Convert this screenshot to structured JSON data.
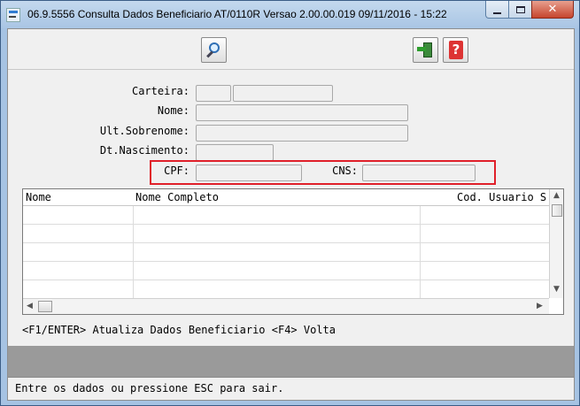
{
  "window": {
    "title": "06.9.5556  Consulta Dados Beneficiario AT/0110R Versao 2.00.00.019 09/11/2016 - 15:22",
    "close_glyph": "✕"
  },
  "toolbar": {
    "search_icon": "magnifier-search-icon",
    "exit_icon": "exit-door-icon",
    "help_icon": "help-question-icon",
    "help_glyph": "?"
  },
  "form": {
    "carteira_label": "Carteira:",
    "nome_label": "Nome:",
    "ult_sobrenome_label": "Ult.Sobrenome:",
    "dt_nascimento_label": "Dt.Nascimento:",
    "cpf_label": "CPF:",
    "cns_label": "CNS:",
    "carteira_value_1": "",
    "carteira_value_2": "",
    "nome_value": "",
    "ult_sobrenome_value": "",
    "dt_nascimento_value": "",
    "cpf_value": "",
    "cns_value": ""
  },
  "grid": {
    "columns": [
      "Nome",
      "Nome Completo",
      "Cod. Usuario S"
    ],
    "rows": [
      [
        "",
        "",
        ""
      ],
      [
        "",
        "",
        ""
      ],
      [
        "",
        "",
        ""
      ],
      [
        "",
        "",
        ""
      ],
      [
        "",
        "",
        ""
      ]
    ]
  },
  "hint": "<F1/ENTER> Atualiza Dados Beneficiario  <F4> Volta",
  "status": "Entre os dados ou pressione ESC para sair.",
  "colors": {
    "highlight_border": "#e0202a",
    "window_frame": "#a6c3e3",
    "client_bg": "#f0f0f0",
    "gray_bar": "#9a9a9a"
  }
}
